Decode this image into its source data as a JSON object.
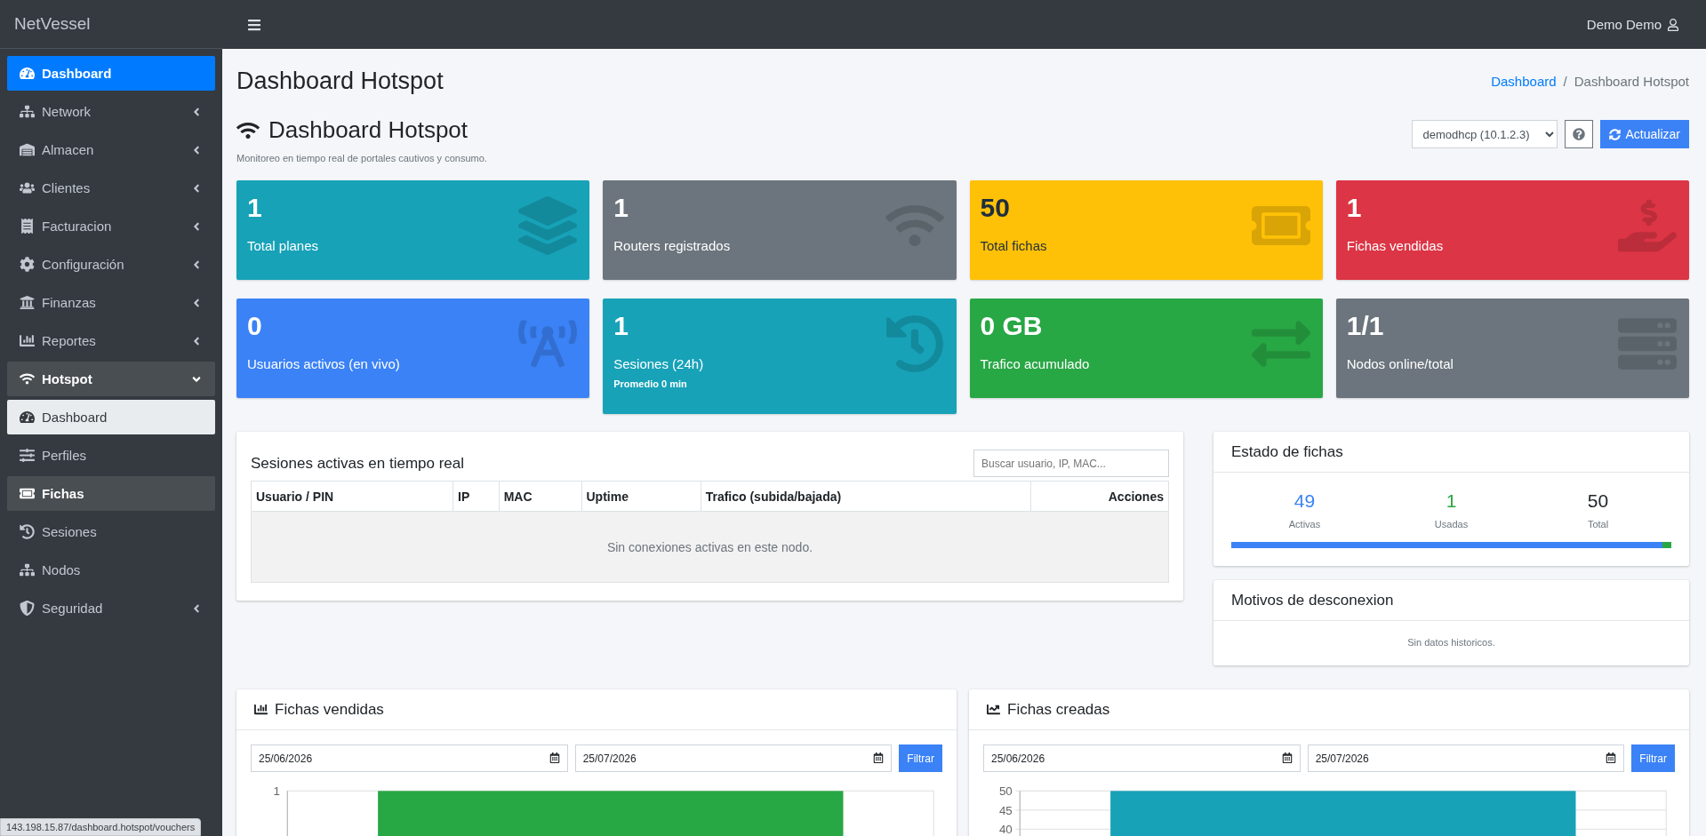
{
  "brand": "NetVessel",
  "sidebar": {
    "items": [
      {
        "label": "Dashboard",
        "selected": true,
        "submenu": false,
        "expanded": false,
        "hovered": false
      },
      {
        "label": "Network",
        "selected": false,
        "submenu": true,
        "expanded": false,
        "hovered": false
      },
      {
        "label": "Almacen",
        "selected": false,
        "submenu": true,
        "expanded": false,
        "hovered": false
      },
      {
        "label": "Clientes",
        "selected": false,
        "submenu": true,
        "expanded": false,
        "hovered": false
      },
      {
        "label": "Facturacion",
        "selected": false,
        "submenu": true,
        "expanded": false,
        "hovered": false
      },
      {
        "label": "Configuración",
        "selected": false,
        "submenu": true,
        "expanded": false,
        "hovered": false
      },
      {
        "label": "Finanzas",
        "selected": false,
        "submenu": true,
        "expanded": false,
        "hovered": false
      },
      {
        "label": "Reportes",
        "selected": false,
        "submenu": true,
        "expanded": false,
        "hovered": false
      },
      {
        "label": "Hotspot",
        "selected": false,
        "submenu": true,
        "expanded": true,
        "hovered": false,
        "children": [
          {
            "label": "Dashboard",
            "selected": true,
            "hovered": false
          },
          {
            "label": "Perfiles",
            "selected": false,
            "hovered": false
          },
          {
            "label": "Fichas",
            "selected": false,
            "hovered": true
          },
          {
            "label": "Sesiones",
            "selected": false,
            "hovered": false
          },
          {
            "label": "Nodos",
            "selected": false,
            "hovered": false
          }
        ]
      },
      {
        "label": "Seguridad",
        "selected": false,
        "submenu": true,
        "expanded": false,
        "hovered": false
      }
    ]
  },
  "topbar": {
    "user": "Demo Demo"
  },
  "page_title": "Dashboard Hotspot",
  "breadcrumb": [
    {
      "label": "Dashboard",
      "link": true
    },
    {
      "label": "Dashboard Hotspot",
      "link": false
    }
  ],
  "breadcrumb_separator": "/",
  "section": {
    "title": "Dashboard Hotspot",
    "subtitle": "Monitoreo en tiempo real de portales cautivos y consumo.",
    "node_select": "demodhcp (10.1.2.3)",
    "refresh_button": "Actualizar"
  },
  "stat_boxes": [
    {
      "value": "1",
      "label": "Total planes",
      "color": "#17a2b8"
    },
    {
      "value": "1",
      "label": "Routers registrados",
      "color": "#6c757d"
    },
    {
      "value": "50",
      "label": "Total fichas",
      "color": "#ffc107"
    },
    {
      "value": "1",
      "label": "Fichas vendidas",
      "color": "#dc3545"
    },
    {
      "value": "0",
      "label": "Usuarios activos (en vivo)",
      "color": "#3b82f6"
    },
    {
      "value": "1",
      "label": "Sesiones (24h)",
      "note": "Promedio 0 min",
      "color": "#17a2b8"
    },
    {
      "value": "0 GB",
      "label": "Trafico acumulado",
      "color": "#28a745"
    },
    {
      "value": "1/1",
      "label": "Nodos online/total",
      "color": "#6c757d"
    }
  ],
  "sessions": {
    "title": "Sesiones activas en tiempo real",
    "search_placeholder": "Buscar usuario, IP, MAC...",
    "columns": [
      "Usuario / PIN",
      "IP",
      "MAC",
      "Uptime",
      "Trafico (subida/bajada)",
      "Acciones"
    ],
    "empty_message": "Sin conexiones activas en este nodo."
  },
  "voucher_status": {
    "title": "Estado de fichas",
    "stats": [
      {
        "value": "49",
        "label": "Activas",
        "color": "#3b82f6"
      },
      {
        "value": "1",
        "label": "Usadas",
        "color": "#28a745"
      },
      {
        "value": "50",
        "label": "Total",
        "color": "#212529"
      }
    ],
    "bar": [
      {
        "level": 0.98,
        "color": "#3b82f6"
      },
      {
        "level": 0.02,
        "color": "#28a745"
      }
    ]
  },
  "disconnect_reasons": {
    "title": "Motivos de desconexion",
    "empty_message": "Sin datos historicos."
  },
  "chart_cards": [
    {
      "title": "Fichas vendidas",
      "date_from": "25/06/2026",
      "date_to": "25/07/2026",
      "button": "Filtrar",
      "chart_data": {
        "type": "bar",
        "series": [
          {
            "color": "#28a745",
            "values": [
              1
            ]
          }
        ],
        "ylim": [
          0,
          1
        ],
        "yticks": [
          1
        ],
        "grid": false
      }
    },
    {
      "title": "Fichas creadas",
      "date_from": "25/06/2026",
      "date_to": "25/07/2026",
      "button": "Filtrar",
      "chart_data": {
        "type": "bar",
        "series": [
          {
            "color": "#17a2b8",
            "values": [
              50
            ]
          }
        ],
        "ylim": [
          0,
          50
        ],
        "yticks": [
          40,
          45,
          50
        ],
        "grid": true
      }
    }
  ],
  "browser_status_url": "143.198.15.87/dashboard.hotspot/vouchers"
}
